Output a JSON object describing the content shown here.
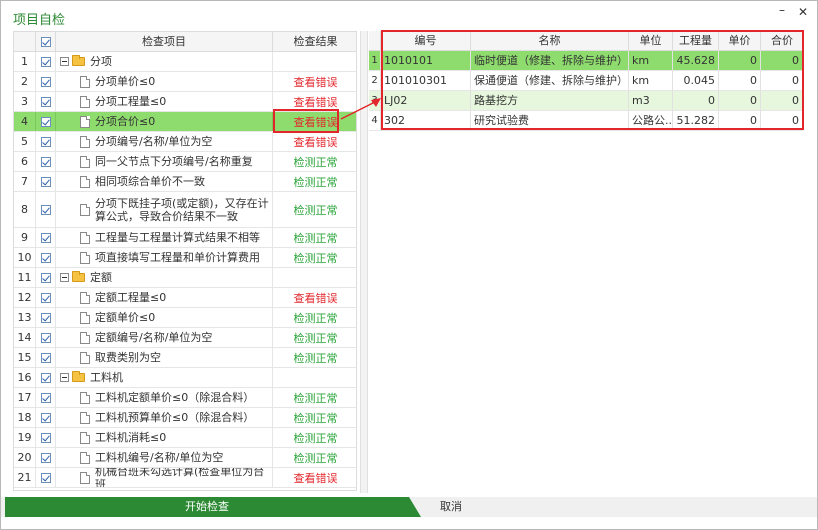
{
  "window": {
    "title": "项目自检",
    "minimize_label": "–",
    "close_label": "✕"
  },
  "left_table": {
    "headers": {
      "check": "☑",
      "item": "检查项目",
      "result": "检查结果"
    },
    "rows": [
      {
        "num": "1",
        "level": 1,
        "type": "folder",
        "name": "分项",
        "result": "",
        "status": ""
      },
      {
        "num": "2",
        "level": 2,
        "type": "doc",
        "name": "分项单价≤0",
        "result": "查看错误",
        "status": "err"
      },
      {
        "num": "3",
        "level": 2,
        "type": "doc",
        "name": "分项工程量≤0",
        "result": "查看错误",
        "status": "err"
      },
      {
        "num": "4",
        "level": 2,
        "type": "doc",
        "name": "分项合价≤0",
        "result": "查看错误",
        "status": "err"
      },
      {
        "num": "5",
        "level": 2,
        "type": "doc",
        "name": "分项编号/名称/单位为空",
        "result": "查看错误",
        "status": "err"
      },
      {
        "num": "6",
        "level": 2,
        "type": "doc",
        "name": "同一父节点下分项编号/名称重复",
        "result": "检测正常",
        "status": "ok"
      },
      {
        "num": "7",
        "level": 2,
        "type": "doc",
        "name": "相同项综合单价不一致",
        "result": "检测正常",
        "status": "ok"
      },
      {
        "num": "8",
        "level": 2,
        "type": "doc",
        "name": "分项下既挂子项(或定额)，又存在计算公式，导致合价结果不一致",
        "result": "检测正常",
        "status": "ok"
      },
      {
        "num": "9",
        "level": 2,
        "type": "doc",
        "name": "工程量与工程量计算式结果不相等",
        "result": "检测正常",
        "status": "ok"
      },
      {
        "num": "10",
        "level": 2,
        "type": "doc",
        "name": "项直接填写工程量和单价计算费用",
        "result": "检测正常",
        "status": "ok"
      },
      {
        "num": "11",
        "level": 1,
        "type": "folder",
        "name": "定额",
        "result": "",
        "status": ""
      },
      {
        "num": "12",
        "level": 2,
        "type": "doc",
        "name": "定额工程量≤0",
        "result": "查看错误",
        "status": "err"
      },
      {
        "num": "13",
        "level": 2,
        "type": "doc",
        "name": "定额单价≤0",
        "result": "检测正常",
        "status": "ok"
      },
      {
        "num": "14",
        "level": 2,
        "type": "doc",
        "name": "定额编号/名称/单位为空",
        "result": "检测正常",
        "status": "ok"
      },
      {
        "num": "15",
        "level": 2,
        "type": "doc",
        "name": "取费类别为空",
        "result": "检测正常",
        "status": "ok"
      },
      {
        "num": "16",
        "level": 1,
        "type": "folder",
        "name": "工料机",
        "result": "",
        "status": ""
      },
      {
        "num": "17",
        "level": 2,
        "type": "doc",
        "name": "工料机定额单价≤0（除混合料）",
        "result": "检测正常",
        "status": "ok"
      },
      {
        "num": "18",
        "level": 2,
        "type": "doc",
        "name": "工料机预算单价≤0（除混合料）",
        "result": "检测正常",
        "status": "ok"
      },
      {
        "num": "19",
        "level": 2,
        "type": "doc",
        "name": "工料机消耗≤0",
        "result": "检测正常",
        "status": "ok"
      },
      {
        "num": "20",
        "level": 2,
        "type": "doc",
        "name": "工料机编号/名称/单位为空",
        "result": "检测正常",
        "status": "ok"
      },
      {
        "num": "21",
        "level": 2,
        "type": "doc",
        "name": "机械台班未勾选计算(检查单位为台班",
        "result": "查看错误",
        "status": "err"
      }
    ]
  },
  "right_table": {
    "headers": {
      "code": "编号",
      "name": "名称",
      "unit": "单位",
      "qty": "工程量",
      "price": "单价",
      "total": "合价"
    },
    "rows": [
      {
        "num": "1",
        "code": "1010101",
        "name": "临时便道（修建、拆除与维护）",
        "unit": "km",
        "qty": "45.628",
        "price": "0",
        "total": "0"
      },
      {
        "num": "2",
        "code": "101010301",
        "name": "保通便道（修建、拆除与维护）",
        "unit": "km",
        "qty": "0.045",
        "price": "0",
        "total": "0"
      },
      {
        "num": "3",
        "code": "LJ02",
        "name": "路基挖方",
        "unit": "m3",
        "qty": "0",
        "price": "0",
        "total": "0"
      },
      {
        "num": "4",
        "code": "302",
        "name": "研究试验费",
        "unit": "公路公...",
        "qty": "51.282",
        "price": "0",
        "total": "0"
      }
    ]
  },
  "footer": {
    "start_label": "开始检查",
    "cancel_label": "取消"
  },
  "colors": {
    "accent": "#2d8a34",
    "selected_row": "#8fdc6e",
    "error": "#e2262b",
    "ok": "#2ba43a"
  }
}
